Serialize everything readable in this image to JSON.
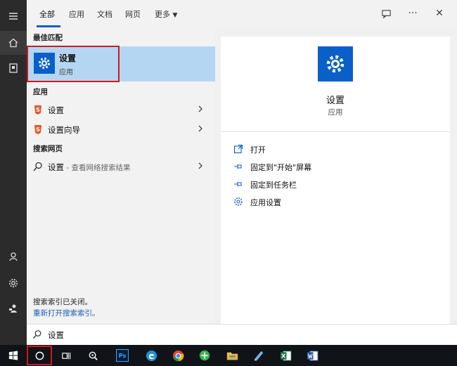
{
  "tabs": [
    {
      "label": "全部",
      "active": true
    },
    {
      "label": "应用"
    },
    {
      "label": "文档"
    },
    {
      "label": "网页"
    },
    {
      "label": "更多"
    }
  ],
  "header_icons": [
    "feedback-icon",
    "more-icon",
    "close-icon"
  ],
  "more_glyph": "···",
  "close_glyph": "✕",
  "sections": {
    "best_match": "最佳匹配",
    "apps": "应用",
    "web": "搜索网页"
  },
  "best_match": {
    "title": "设置",
    "subtitle": "应用",
    "icon": "gear-icon"
  },
  "apps": [
    {
      "label": "设置",
      "icon": "app-s-icon"
    },
    {
      "label": "设置向导",
      "icon": "app-s-icon"
    }
  ],
  "web": {
    "query": "设置",
    "suffix": " - 查看网络搜索结果"
  },
  "index_note": "搜索索引已关闭。",
  "index_link": "重新打开搜索索引。",
  "preview": {
    "title": "设置",
    "subtitle": "应用",
    "actions": [
      {
        "label": "打开",
        "icon": "open-icon"
      },
      {
        "label": "固定到\"开始\"屏幕",
        "icon": "pin-icon"
      },
      {
        "label": "固定到任务栏",
        "icon": "pin-icon"
      },
      {
        "label": "应用设置",
        "icon": "gear-icon"
      }
    ]
  },
  "search": {
    "value": "设置"
  },
  "taskbar": [
    "windows-start-icon",
    "search-circle-icon",
    "task-view-icon",
    "magnifier-app-icon",
    "photoshop-icon",
    "edge-icon",
    "chrome-icon",
    "green-app-icon",
    "file-explorer-icon",
    "notepad-app-icon",
    "excel-icon",
    "word-icon"
  ],
  "taskbar_labels": {
    "photoshop": "Ps"
  },
  "colors": {
    "accent": "#0a60c8",
    "highlight": "#b5d6f2",
    "red_outline": "#d0181e"
  }
}
